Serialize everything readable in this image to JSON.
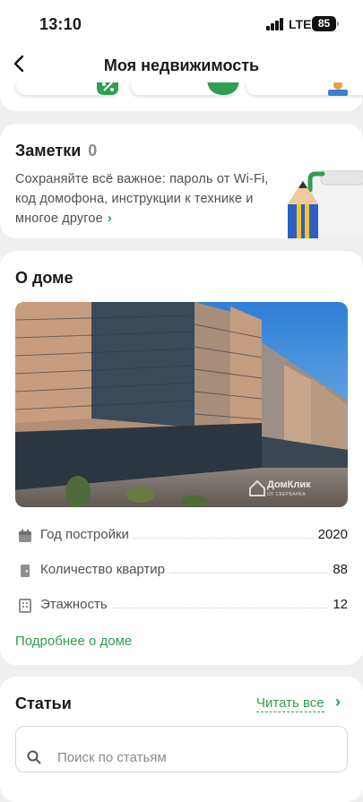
{
  "status_bar": {
    "time": "13:10",
    "network": "LTE",
    "battery": "85"
  },
  "nav": {
    "title": "Моя недвижимость",
    "back_icon": "chevron-left-icon"
  },
  "notes": {
    "title": "Заметки",
    "count": "0",
    "description": "Сохраняйте всё важное: пароль от Wi-Fi, код домофона, инструкции к технике и многое другое",
    "chevron": "›"
  },
  "about_house": {
    "title": "О доме",
    "photo_watermark": {
      "brand": "ДомКлик",
      "sub": "ОТ СБЕРБАНКА"
    },
    "rows": [
      {
        "icon": "calendar-icon",
        "label": "Год постройки",
        "value": "2020"
      },
      {
        "icon": "door-icon",
        "label": "Количество квартир",
        "value": "88"
      },
      {
        "icon": "building-icon",
        "label": "Этажность",
        "value": "12"
      }
    ],
    "more_link": "Подробнее о доме"
  },
  "articles": {
    "title": "Статьи",
    "read_all": "Читать все",
    "read_all_chevron": "›",
    "search_placeholder": "Поиск по статьям"
  },
  "colors": {
    "accent": "#2f9e52",
    "background": "#eef0ee",
    "card": "#ffffff"
  }
}
